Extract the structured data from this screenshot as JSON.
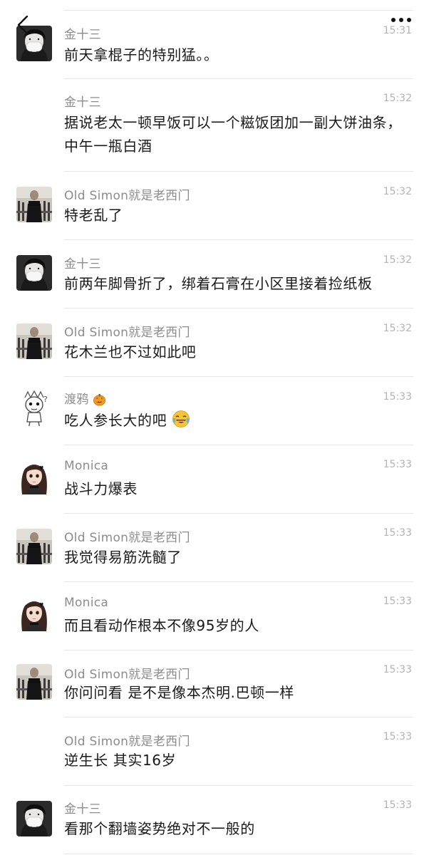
{
  "nav": {
    "back_icon": "chevron-left-icon",
    "more_icon": "more-dots-icon"
  },
  "messages": [
    {
      "sender": "金十三",
      "time": "15:31",
      "text": "前天拿棍子的特别猛。。",
      "avatar": "kid-mask"
    },
    {
      "sender": "金十三",
      "time": "15:32",
      "text": "据说老太一顿早饭可以一个糍饭团加一副大饼油条，中午一瓶白酒",
      "avatar": ""
    },
    {
      "sender": "Old Simon就是老西门",
      "time": "15:32",
      "text": "特老乱了",
      "avatar": "gym"
    },
    {
      "sender": "金十三",
      "time": "15:32",
      "text": "前两年脚骨折了，绑着石膏在小区里接着捡纸板",
      "avatar": "kid-mask"
    },
    {
      "sender": "Old Simon就是老西门",
      "time": "15:32",
      "text": "花木兰也不过如此吧",
      "avatar": "gym"
    },
    {
      "sender": "渡鸦",
      "sender_emoji": "jack-o-lantern-icon",
      "time": "15:33",
      "text": "吃人参长大的吧",
      "text_emoji": "laughing-crying-icon",
      "avatar": "sketch"
    },
    {
      "sender": "Monica",
      "time": "15:33",
      "text": "战斗力爆表",
      "avatar": "girl"
    },
    {
      "sender": "Old Simon就是老西门",
      "time": "15:33",
      "text": "我觉得易筋洗髓了",
      "avatar": "gym"
    },
    {
      "sender": "Monica",
      "time": "15:33",
      "text": "而且看动作根本不像95岁的人",
      "avatar": "girl"
    },
    {
      "sender": "Old Simon就是老西门",
      "time": "15:33",
      "text": "你问问看 是不是像本杰明.巴顿一样",
      "avatar": "gym"
    },
    {
      "sender": "Old Simon就是老西门",
      "time": "15:33",
      "text": "逆生长 其实16岁",
      "avatar": ""
    },
    {
      "sender": "金十三",
      "time": "15:33",
      "text": "看那个翻墙姿势绝对不一般的",
      "avatar": "kid-mask"
    }
  ]
}
